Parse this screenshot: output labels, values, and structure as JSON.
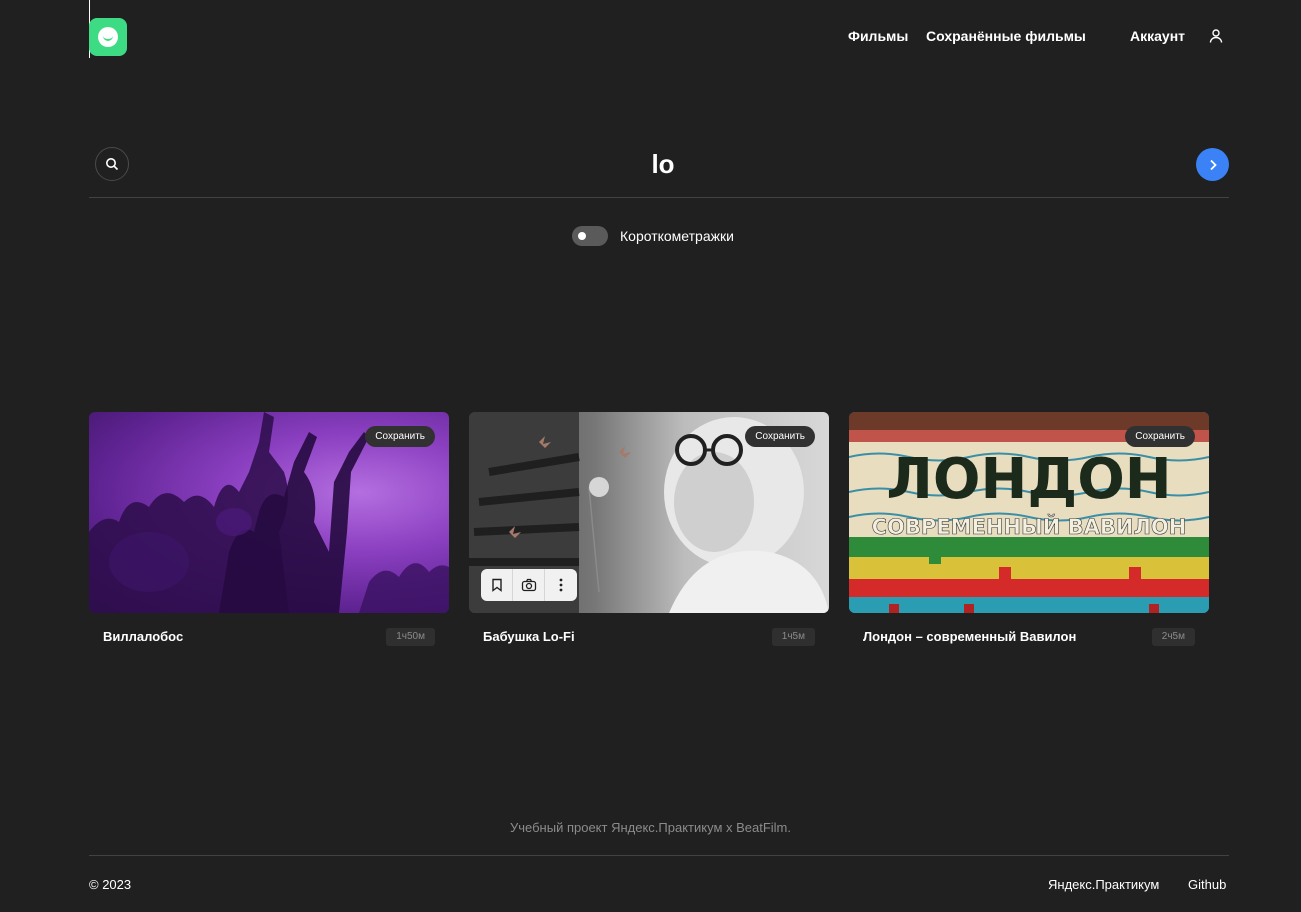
{
  "header": {
    "logo_icon": "smile-logo-icon",
    "nav": {
      "films": "Фильмы",
      "saved": "Сохранённые фильмы",
      "account": "Аккаунт"
    },
    "account_icon": "user-icon"
  },
  "search": {
    "value": "lo",
    "search_icon": "search-icon",
    "submit_icon": "chevron-right-icon",
    "accent": "#3b82f6"
  },
  "filter": {
    "shorts_label": "Короткометражки",
    "shorts_enabled": false
  },
  "movies": [
    {
      "title": "Виллалобос",
      "duration": "1ч50м",
      "save_label": "Сохранить"
    },
    {
      "title": "Бабушка Lo-Fi",
      "duration": "1ч5м",
      "save_label": "Сохранить"
    },
    {
      "title": "Лондон – современный Вавилон",
      "duration": "2ч5м",
      "save_label": "Сохранить"
    }
  ],
  "poster_text": {
    "london_title": "ЛОНДОН",
    "london_subtitle": "СОВРЕМЕННЫЙ ВАВИЛОН"
  },
  "footer": {
    "note": "Учебный проект Яндекс.Практикум х BeatFilm.",
    "copyright": "© 2023",
    "links": [
      "Яндекс.Практикум",
      "Github"
    ]
  },
  "colors": {
    "background": "#202020",
    "logo_green": "#3ddc84"
  }
}
